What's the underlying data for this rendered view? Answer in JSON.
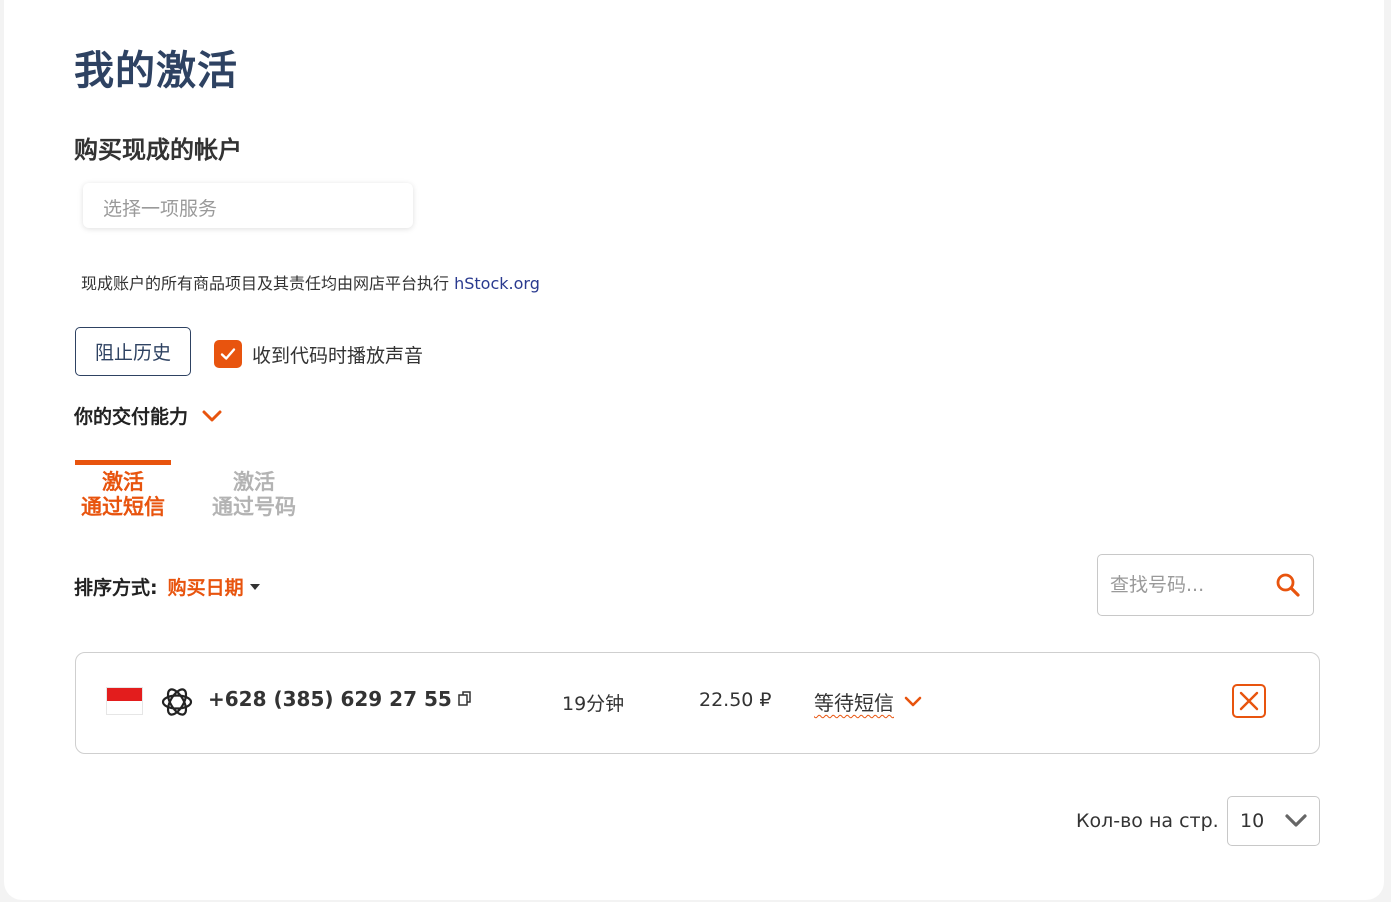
{
  "page": {
    "title": "我的激活"
  },
  "accounts": {
    "section_title": "购买现成的帐户",
    "service_placeholder": "选择一项服务",
    "notice_text": "现成账户的所有商品项目及其责任均由网店平台执行",
    "notice_link": "hStock.org"
  },
  "controls": {
    "block_history_label": "阻止历史",
    "sound_label": "收到代码时播放声音",
    "sound_checked": true,
    "delivery_label": "你的交付能力"
  },
  "tabs": [
    {
      "line1": "激活",
      "line2": "通过短信",
      "active": true
    },
    {
      "line1": "激活",
      "line2": "通过号码",
      "active": false
    }
  ],
  "sort": {
    "label": "排序方式:",
    "value": "购买日期"
  },
  "search": {
    "placeholder": "查找号码..."
  },
  "activations": [
    {
      "country_flag": "indonesia-flag",
      "service_icon": "openai-icon",
      "phone": "+628 (385) 629 27 55",
      "time": "19分钟",
      "price": "22.50 ₽",
      "status": "等待短信"
    }
  ],
  "pagination": {
    "per_page_label": "Кол-во на стр.",
    "per_page_value": "10"
  },
  "colors": {
    "accent": "#e8540e",
    "title": "#2e4262",
    "link": "#2a3a8f"
  }
}
